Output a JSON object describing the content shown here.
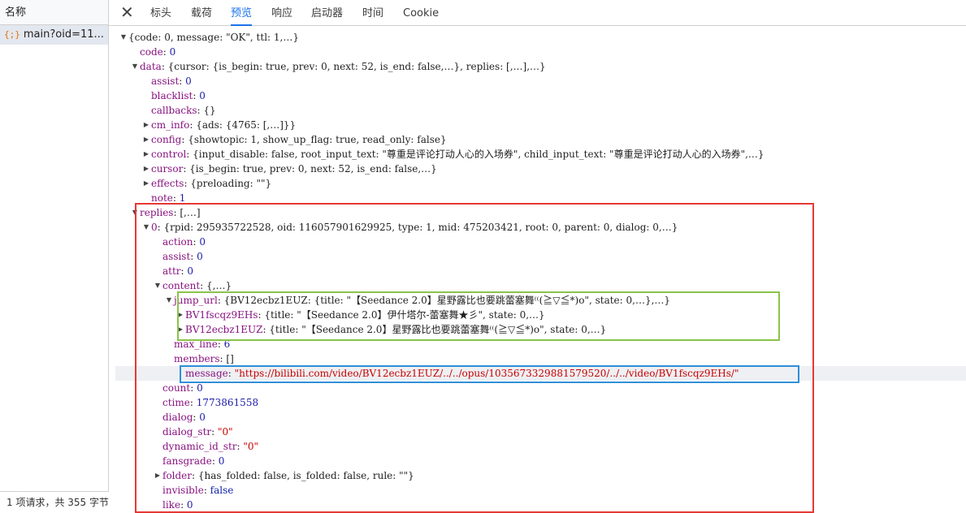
{
  "request_list": {
    "header": "名称",
    "item_icon": "{;}",
    "item_label": "main?oid=11...",
    "footer": "1 项请求，共 355 字节"
  },
  "tabs": [
    "标头",
    "载荷",
    "预览",
    "响应",
    "启动器",
    "时间",
    "Cookie"
  ],
  "active_tab": "预览",
  "tree": [
    {
      "tri": "down",
      "key": "",
      "sep": "",
      "val": "{code: 0, message: \"OK\", ttl: 1,…}",
      "type": "plain"
    },
    {
      "tri": "",
      "key": "code",
      "sep": ": ",
      "val": "0",
      "type": "num"
    },
    {
      "tri": "down",
      "key": "data",
      "sep": ": ",
      "val": "{cursor: {is_begin: true, prev: 0, next: 52, is_end: false,…}, replies: [,…],…}",
      "type": "plain"
    },
    {
      "tri": "",
      "key": "assist",
      "sep": ": ",
      "val": "0",
      "type": "num"
    },
    {
      "tri": "",
      "key": "blacklist",
      "sep": ": ",
      "val": "0",
      "type": "num"
    },
    {
      "tri": "",
      "key": "callbacks",
      "sep": ": ",
      "val": "{}",
      "type": "plain"
    },
    {
      "tri": "right",
      "key": "cm_info",
      "sep": ": ",
      "val": "{ads: {4765: [,…]}}",
      "type": "plain"
    },
    {
      "tri": "right",
      "key": "config",
      "sep": ": ",
      "val": "{showtopic: 1, show_up_flag: true, read_only: false}",
      "type": "plain"
    },
    {
      "tri": "right",
      "key": "control",
      "sep": ": ",
      "val": "{input_disable: false, root_input_text: \"尊重是评论打动人心的入场券\", child_input_text: \"尊重是评论打动人心的入场券\",…}",
      "type": "plain"
    },
    {
      "tri": "right",
      "key": "cursor",
      "sep": ": ",
      "val": "{is_begin: true, prev: 0, next: 52, is_end: false,…}",
      "type": "plain"
    },
    {
      "tri": "right",
      "key": "effects",
      "sep": ": ",
      "val": "{preloading: \"\"}",
      "type": "plain"
    },
    {
      "tri": "",
      "key": "note",
      "sep": ": ",
      "val": "1",
      "type": "num"
    },
    {
      "tri": "down",
      "key": "replies",
      "sep": ": ",
      "val": "[,…]",
      "type": "plain"
    },
    {
      "tri": "down",
      "key": "0",
      "sep": ": ",
      "val": "{rpid: 295935722528, oid: 116057901629925, type: 1, mid: 475203421, root: 0, parent: 0, dialog: 0,…}",
      "type": "plain"
    },
    {
      "tri": "",
      "key": "action",
      "sep": ": ",
      "val": "0",
      "type": "num"
    },
    {
      "tri": "",
      "key": "assist",
      "sep": ": ",
      "val": "0",
      "type": "num"
    },
    {
      "tri": "",
      "key": "attr",
      "sep": ": ",
      "val": "0",
      "type": "num"
    },
    {
      "tri": "down",
      "key": "content",
      "sep": ": ",
      "val": "{,…}",
      "type": "plain"
    },
    {
      "tri": "down",
      "key": "jump_url",
      "sep": ": ",
      "val": "{BV12ecbz1EUZ: {title: \"【Seedance 2.0】星野露比也要跳蕾塞舞⁽⁽(≧▽≦*)o\", state: 0,…},…}",
      "type": "plain"
    },
    {
      "tri": "right",
      "key": "BV1fscqz9EHs",
      "sep": ": ",
      "val": "{title: \"【Seedance 2.0】伊什塔尔-蕾塞舞★彡\", state: 0,…}",
      "type": "plain"
    },
    {
      "tri": "right",
      "key": "BV12ecbz1EUZ",
      "sep": ": ",
      "val": "{title: \"【Seedance 2.0】星野露比也要跳蕾塞舞⁽⁽(≧▽≦*)o\", state: 0,…}",
      "type": "plain"
    },
    {
      "tri": "",
      "key": "max_line",
      "sep": ": ",
      "val": "6",
      "type": "num"
    },
    {
      "tri": "",
      "key": "members",
      "sep": ": ",
      "val": "[]",
      "type": "plain"
    },
    {
      "tri": "",
      "key": "message",
      "sep": ": ",
      "val": "\"https://bilibili.com/video/BV12ecbz1EUZ/../../opus/1035673329881579520/../../video/BV1fscqz9EHs/\"",
      "type": "str"
    },
    {
      "tri": "",
      "key": "count",
      "sep": ": ",
      "val": "0",
      "type": "num"
    },
    {
      "tri": "",
      "key": "ctime",
      "sep": ": ",
      "val": "1773861558",
      "type": "num"
    },
    {
      "tri": "",
      "key": "dialog",
      "sep": ": ",
      "val": "0",
      "type": "num"
    },
    {
      "tri": "",
      "key": "dialog_str",
      "sep": ": ",
      "val": "\"0\"",
      "type": "str"
    },
    {
      "tri": "",
      "key": "dynamic_id_str",
      "sep": ": ",
      "val": "\"0\"",
      "type": "str"
    },
    {
      "tri": "",
      "key": "fansgrade",
      "sep": ": ",
      "val": "0",
      "type": "num"
    },
    {
      "tri": "right",
      "key": "folder",
      "sep": ": ",
      "val": "{has_folded: false, is_folded: false, rule: \"\"}",
      "type": "plain"
    },
    {
      "tri": "",
      "key": "invisible",
      "sep": ": ",
      "val": "false",
      "type": "bool"
    },
    {
      "tri": "",
      "key": "like",
      "sep": ": ",
      "val": "0",
      "type": "num"
    }
  ],
  "colors": {
    "red_box": "#e53935",
    "green_box": "#8bc34a",
    "blue_box": "#2f8fd8",
    "active_tab": "#1a73e8"
  }
}
